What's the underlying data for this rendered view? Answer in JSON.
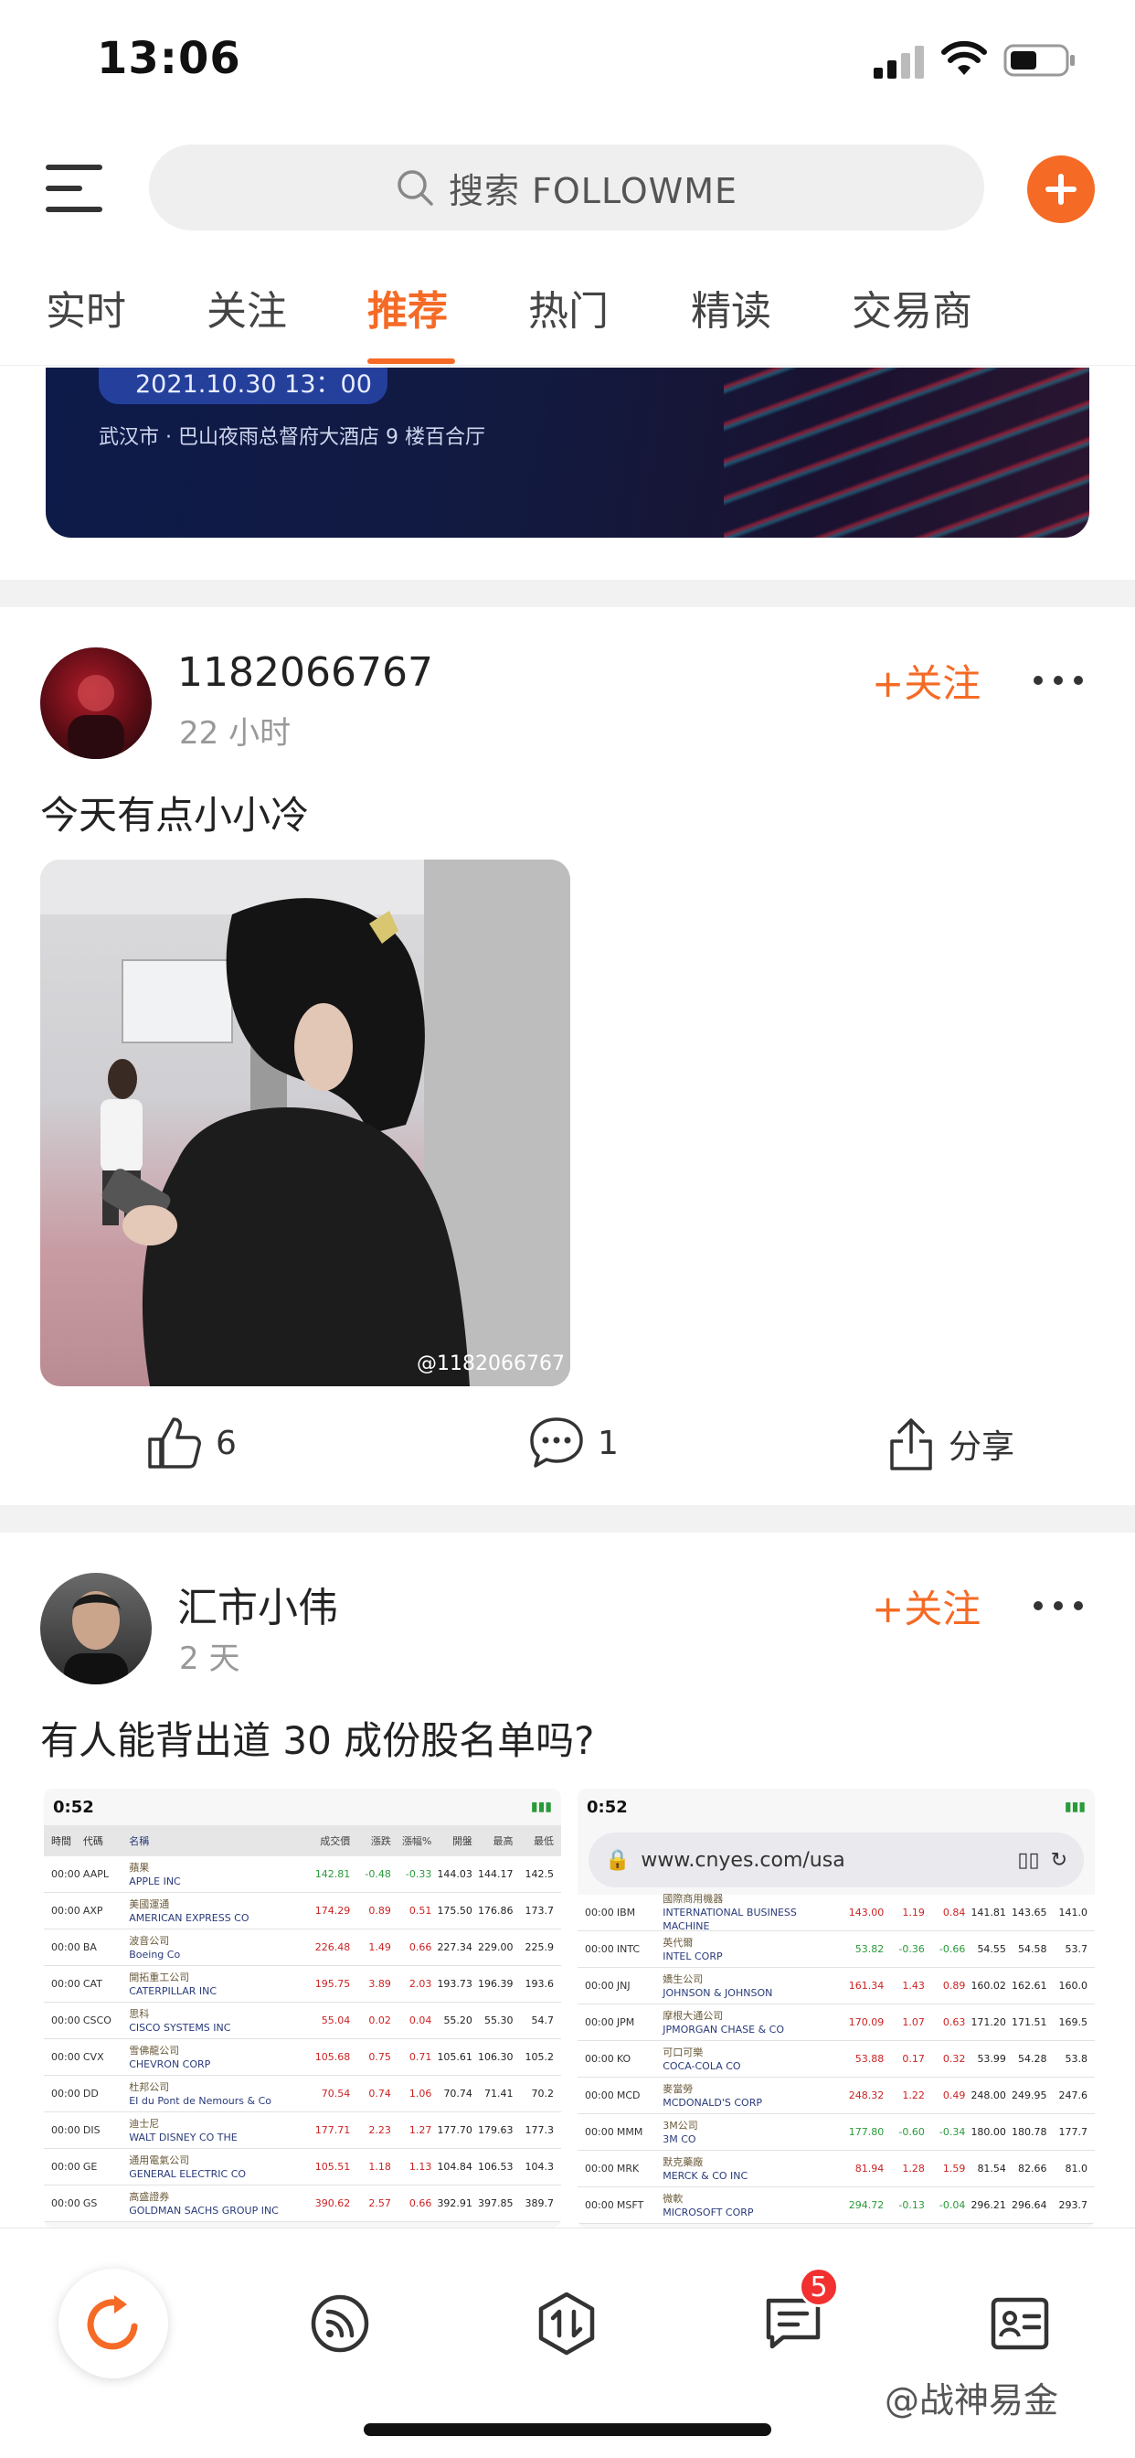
{
  "status_bar": {
    "time": "13:06"
  },
  "header": {
    "search_placeholder": "搜索 FOLLOWME"
  },
  "tabs": [
    {
      "label": "实时"
    },
    {
      "label": "关注"
    },
    {
      "label": "推荐"
    },
    {
      "label": "热门"
    },
    {
      "label": "精读"
    },
    {
      "label": "交易商"
    }
  ],
  "active_tab": "推荐",
  "banner": {
    "date": "2021.10.30 13：00",
    "venue": "武汉市 · 巴山夜雨总督府大酒店 9 楼百合厅"
  },
  "posts": [
    {
      "author": "1182066767",
      "time": "22 小时",
      "follow_label": "+关注",
      "text": "今天有点小小冷",
      "image_watermark": "@1182066767",
      "likes": "6",
      "comments": "1",
      "share_label": "分享"
    },
    {
      "author": "汇市小伟",
      "time": "2 天",
      "follow_label": "+关注",
      "text": "有人能背出道 30 成份股名单吗?",
      "shot_left": {
        "time": "0:52",
        "headers": [
          "時間",
          "代碼",
          "名稱",
          "成交價",
          "漲跌",
          "漲幅%",
          "開盤",
          "最高",
          "最低"
        ],
        "rows": [
          {
            "t": "00:00",
            "code": "AAPL",
            "zh": "蘋果",
            "en": "APPLE INC",
            "price": "142.81",
            "chg": "-0.48",
            "pct": "-0.33",
            "open": "144.03",
            "high": "144.17",
            "low": "142.5"
          },
          {
            "t": "00:00",
            "code": "AXP",
            "zh": "美國運通",
            "en": "AMERICAN EXPRESS CO",
            "price": "174.29",
            "chg": "0.89",
            "pct": "0.51",
            "open": "175.50",
            "high": "176.86",
            "low": "173.7"
          },
          {
            "t": "00:00",
            "code": "BA",
            "zh": "波音公司",
            "en": "Boeing Co",
            "price": "226.48",
            "chg": "1.49",
            "pct": "0.66",
            "open": "227.34",
            "high": "229.00",
            "low": "225.9"
          },
          {
            "t": "00:00",
            "code": "CAT",
            "zh": "開拓重工公司",
            "en": "CATERPILLAR INC",
            "price": "195.75",
            "chg": "3.89",
            "pct": "2.03",
            "open": "193.73",
            "high": "196.39",
            "low": "193.6"
          },
          {
            "t": "00:00",
            "code": "CSCO",
            "zh": "思科",
            "en": "CISCO SYSTEMS INC",
            "price": "55.04",
            "chg": "0.02",
            "pct": "0.04",
            "open": "55.20",
            "high": "55.30",
            "low": "54.7"
          },
          {
            "t": "00:00",
            "code": "CVX",
            "zh": "雪佛龍公司",
            "en": "CHEVRON CORP",
            "price": "105.68",
            "chg": "0.75",
            "pct": "0.71",
            "open": "105.61",
            "high": "106.30",
            "low": "105.2"
          },
          {
            "t": "00:00",
            "code": "DD",
            "zh": "杜邦公司",
            "en": "EI du Pont de Nemours & Co",
            "price": "70.54",
            "chg": "0.74",
            "pct": "1.06",
            "open": "70.74",
            "high": "71.41",
            "low": "70.2"
          },
          {
            "t": "00:00",
            "code": "DIS",
            "zh": "迪士尼",
            "en": "WALT DISNEY CO THE",
            "price": "177.71",
            "chg": "2.23",
            "pct": "1.27",
            "open": "177.70",
            "high": "179.63",
            "low": "177.3"
          },
          {
            "t": "00:00",
            "code": "GE",
            "zh": "通用電氣公司",
            "en": "GENERAL ELECTRIC CO",
            "price": "105.51",
            "chg": "1.18",
            "pct": "1.13",
            "open": "104.84",
            "high": "106.53",
            "low": "104.3"
          },
          {
            "t": "00:00",
            "code": "GS",
            "zh": "高盛證券",
            "en": "GOLDMAN SACHS GROUP INC",
            "price": "390.62",
            "chg": "2.57",
            "pct": "0.66",
            "open": "392.91",
            "high": "397.85",
            "low": "389.7"
          }
        ]
      },
      "shot_right": {
        "time": "0:52",
        "url": "www.cnyes.com/usa",
        "rows": [
          {
            "t": "00:00",
            "code": "IBM",
            "zh": "國際商用機器",
            "en": "INTERNATIONAL BUSINESS MACHINE",
            "price": "143.00",
            "chg": "1.19",
            "pct": "0.84",
            "open": "141.81",
            "high": "143.65",
            "low": "141.0"
          },
          {
            "t": "00:00",
            "code": "INTC",
            "zh": "英代爾",
            "en": "INTEL CORP",
            "price": "53.82",
            "chg": "-0.36",
            "pct": "-0.66",
            "open": "54.55",
            "high": "54.58",
            "low": "53.7"
          },
          {
            "t": "00:00",
            "code": "JNJ",
            "zh": "嬌生公司",
            "en": "JOHNSON & JOHNSON",
            "price": "161.34",
            "chg": "1.43",
            "pct": "0.89",
            "open": "160.02",
            "high": "162.61",
            "low": "160.0"
          },
          {
            "t": "00:00",
            "code": "JPM",
            "zh": "摩根大通公司",
            "en": "JPMORGAN CHASE & CO",
            "price": "170.09",
            "chg": "1.07",
            "pct": "0.63",
            "open": "171.20",
            "high": "171.51",
            "low": "169.5"
          },
          {
            "t": "00:00",
            "code": "KO",
            "zh": "可口可樂",
            "en": "COCA-COLA CO",
            "price": "53.88",
            "chg": "0.17",
            "pct": "0.32",
            "open": "53.99",
            "high": "54.28",
            "low": "53.8"
          },
          {
            "t": "00:00",
            "code": "MCD",
            "zh": "麥當勞",
            "en": "MCDONALD'S CORP",
            "price": "248.32",
            "chg": "1.22",
            "pct": "0.49",
            "open": "248.00",
            "high": "249.95",
            "low": "247.6"
          },
          {
            "t": "00:00",
            "code": "MMM",
            "zh": "3M公司",
            "en": "3M CO",
            "price": "177.80",
            "chg": "-0.60",
            "pct": "-0.34",
            "open": "180.00",
            "high": "180.78",
            "low": "177.7"
          },
          {
            "t": "00:00",
            "code": "MRK",
            "zh": "默克藥廠",
            "en": "MERCK & CO INC",
            "price": "81.94",
            "chg": "1.28",
            "pct": "1.59",
            "open": "81.54",
            "high": "82.66",
            "low": "81.0"
          },
          {
            "t": "00:00",
            "code": "MSFT",
            "zh": "微軟",
            "en": "MICROSOFT CORP",
            "price": "294.72",
            "chg": "-0.13",
            "pct": "-0.04",
            "open": "296.21",
            "high": "296.64",
            "low": "293.7"
          }
        ]
      }
    }
  ],
  "bottom_nav": {
    "badge_count": "5",
    "items": [
      "refresh-icon",
      "feed-icon",
      "trade-icon",
      "messages-icon",
      "profile-card-icon"
    ]
  },
  "watermark": "@战神易金",
  "colors": {
    "accent": "#f56a25",
    "badge": "#f23030"
  }
}
